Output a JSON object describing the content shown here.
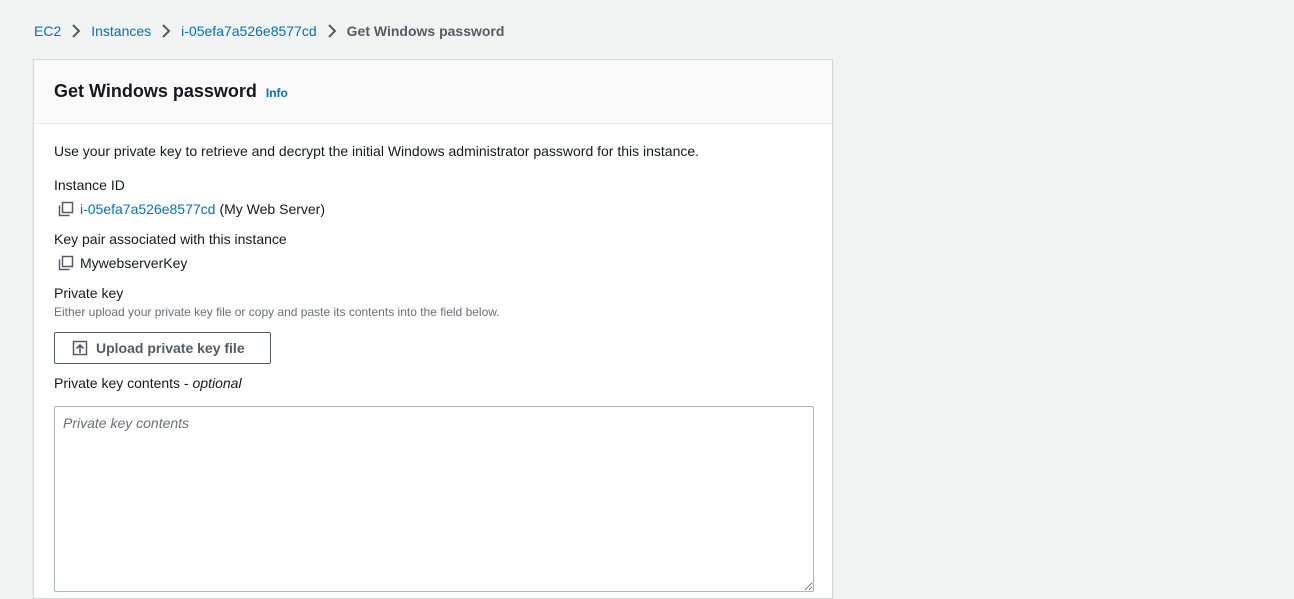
{
  "breadcrumb": {
    "items": [
      "EC2",
      "Instances",
      "i-05efa7a526e8577cd"
    ],
    "current": "Get Windows password"
  },
  "panel": {
    "title": "Get Windows password",
    "info_label": "Info",
    "description": "Use your private key to retrieve and decrypt the initial Windows administrator password for this instance.",
    "instance_id_label": "Instance ID",
    "instance_id_value": "i-05efa7a526e8577cd",
    "instance_name": "(My Web Server)",
    "key_pair_label": "Key pair associated with this instance",
    "key_pair_value": "MywebserverKey",
    "private_key_label": "Private key",
    "private_key_hint": "Either upload your private key file or copy and paste its contents into the field below.",
    "upload_button_label": "Upload private key file",
    "contents_label": "Private key contents - ",
    "contents_optional": "optional",
    "contents_placeholder": "Private key contents",
    "contents_value": ""
  },
  "icons": {
    "breadcrumb_separator": "chevron-right-icon",
    "copy": "copy-icon",
    "upload": "upload-icon"
  },
  "colors": {
    "link": "#0073bb",
    "background": "#f2f3f3",
    "text": "#16191f",
    "muted": "#687078"
  }
}
